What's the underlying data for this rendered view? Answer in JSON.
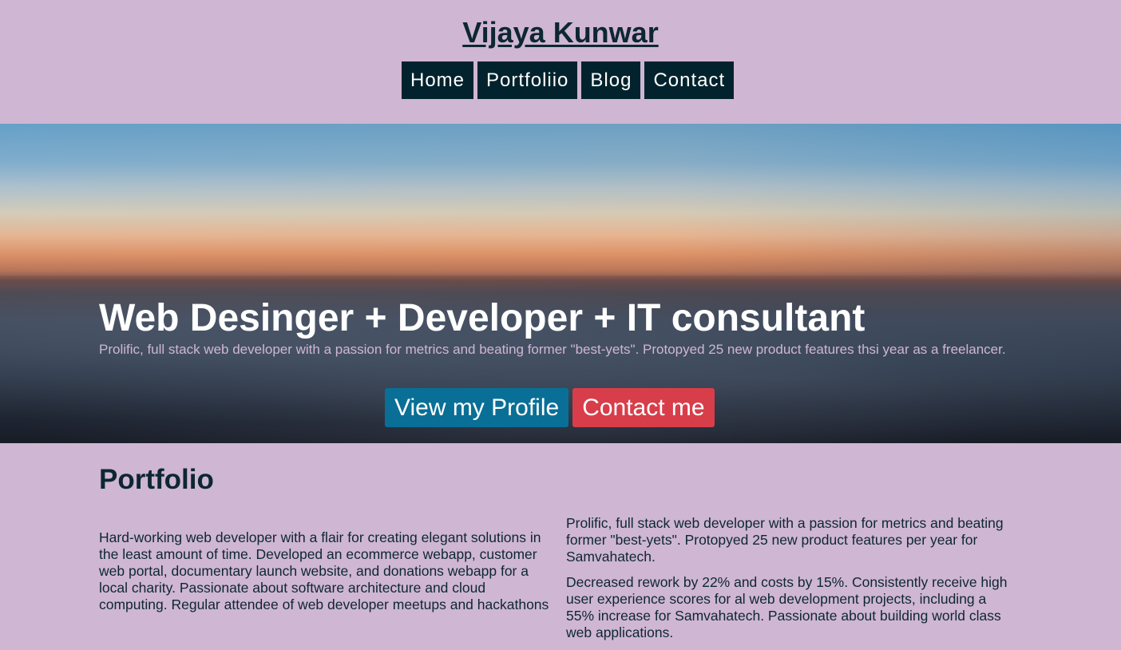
{
  "header": {
    "title": "Vijaya Kunwar",
    "nav": [
      "Home",
      "Portfoliio",
      "Blog",
      "Contact"
    ]
  },
  "hero": {
    "title": "Web Desinger + Developer + IT consultant",
    "text": "Prolific, full stack web developer with a passion for metrics and beating former \"best-yets\". Protopyed 25 new product features thsi year as a freelancer.",
    "buttons": {
      "profile": "View my Profile",
      "contact": "Contact me"
    }
  },
  "portfolio": {
    "title": "Portfolio",
    "left": "Hard-working web developer with a flair for creating elegant solutions in the least amount of time. Developed an ecommerce webapp, customer web portal, documentary launch website, and donations webapp for a local charity. Passionate about software architecture and cloud computing. Regular attendee of web developer meetups and hackathons",
    "right": [
      "Prolific, full stack web developer with a passion for metrics and beating former \"best-yets\". Protopyed 25 new product features per year for Samvahatech.",
      "Decreased rework by 22% and costs by 15%. Consistently receive high user experience scores for al web development projects, including a 55% increase for Samvahatech. Passionate about building world class web applications."
    ]
  },
  "colors": {
    "page_background": "#cfb6d3",
    "nav_background": "#02232d",
    "text_dark": "#0d2732",
    "profile_button": "#0a6f96",
    "contact_button": "#d73e4a"
  }
}
